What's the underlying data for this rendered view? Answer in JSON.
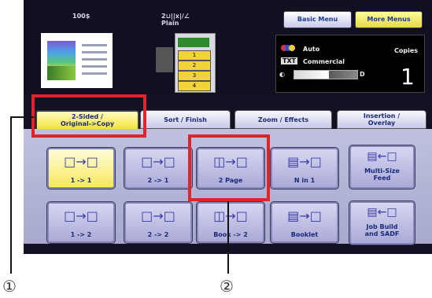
{
  "status": {
    "paper_count": "100$",
    "paper_info_line1": "2⊔||x|/∠",
    "paper_info_line2": "Plain",
    "tray_labels": [
      "1",
      "2",
      "3",
      "4"
    ]
  },
  "menu_buttons": {
    "basic": "Basic Menu",
    "more": "More Menus"
  },
  "settings": {
    "auto_label": "Auto",
    "mode_label": "Commercial",
    "contrast_level": 0.55,
    "copies_label": "Copies",
    "copies_value": "1"
  },
  "tabs": [
    {
      "label1": "2-Sided /",
      "label2": "Original->Copy",
      "active": true
    },
    {
      "label1": "Sort / Finish",
      "label2": "",
      "active": false
    },
    {
      "label1": "Zoom / Effects",
      "label2": "",
      "active": false
    },
    {
      "label1": "Insertion /",
      "label2": "Overlay",
      "active": false
    }
  ],
  "options": [
    {
      "label": "1 -> 1",
      "icon": "sheet-to-sheet-icon"
    },
    {
      "label": "2 -> 1",
      "icon": "sheet-to-sheet-icon"
    },
    {
      "label": "2 Page",
      "icon": "book-to-sheet-icon"
    },
    {
      "label": "N in 1",
      "icon": "multi-sheet-icon"
    },
    {
      "label": "1 -> 2",
      "icon": "sheet-to-sheet-icon"
    },
    {
      "label": "2 -> 2",
      "icon": "sheet-to-sheet-icon"
    },
    {
      "label": "Book -> 2",
      "icon": "book-to-sheet-icon"
    },
    {
      "label": "Booklet",
      "icon": "booklet-icon"
    }
  ],
  "side_options": [
    {
      "label1": "Multi-Size",
      "label2": "Feed"
    },
    {
      "label1": "Job Build",
      "label2": "and SADF"
    }
  ],
  "callouts": {
    "one": "①",
    "two": "②"
  }
}
